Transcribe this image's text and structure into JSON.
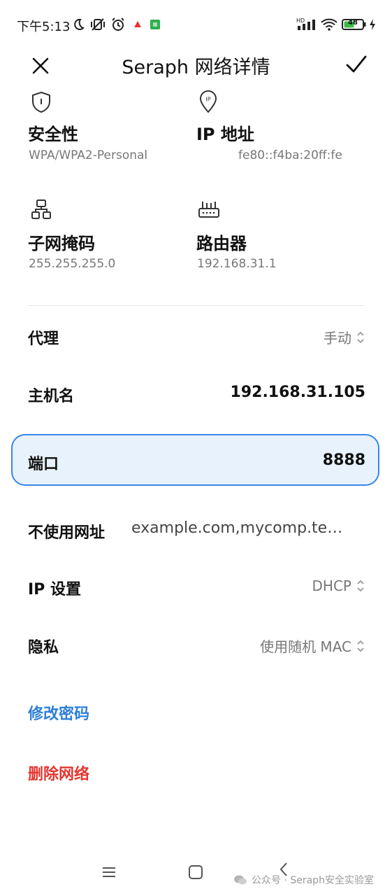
{
  "status_bar": {
    "time": "下午5:13",
    "signal_label": "HD",
    "battery": "48"
  },
  "header": {
    "title": "Seraph 网络详情",
    "close_icon": "close-icon",
    "confirm_icon": "check-icon"
  },
  "info": {
    "security": {
      "label": "安全性",
      "value": "WPA/WPA2-Personal",
      "icon": "shield-icon"
    },
    "ip": {
      "label": "IP 地址",
      "value": "fe80::f4ba:20ff:fe",
      "icon": "ip-pin-icon"
    },
    "subnet": {
      "label": "子网掩码",
      "value": "255.255.255.0",
      "icon": "network-tree-icon"
    },
    "router": {
      "label": "路由器",
      "value": "192.168.31.1",
      "icon": "router-icon"
    }
  },
  "settings": {
    "proxy": {
      "label": "代理",
      "value": "手动"
    },
    "hostname": {
      "label": "主机名",
      "value": "192.168.31.105"
    },
    "port": {
      "label": "端口",
      "value": "8888"
    },
    "bypass": {
      "label": "不使用网址",
      "value": "example.com,mycomp.te…"
    },
    "ip_settings": {
      "label": "IP 设置",
      "value": "DHCP"
    },
    "privacy": {
      "label": "隐私",
      "value": "使用随机 MAC"
    }
  },
  "actions": {
    "modify_password": "修改密码",
    "delete_network": "删除网络"
  },
  "colors": {
    "accent_blue": "#2d7fd6",
    "danger_red": "#e5352f",
    "focus_border": "#3a86e8",
    "focus_fill": "#e8f2fc"
  },
  "watermark": "公众号 · Seraph安全实验室"
}
